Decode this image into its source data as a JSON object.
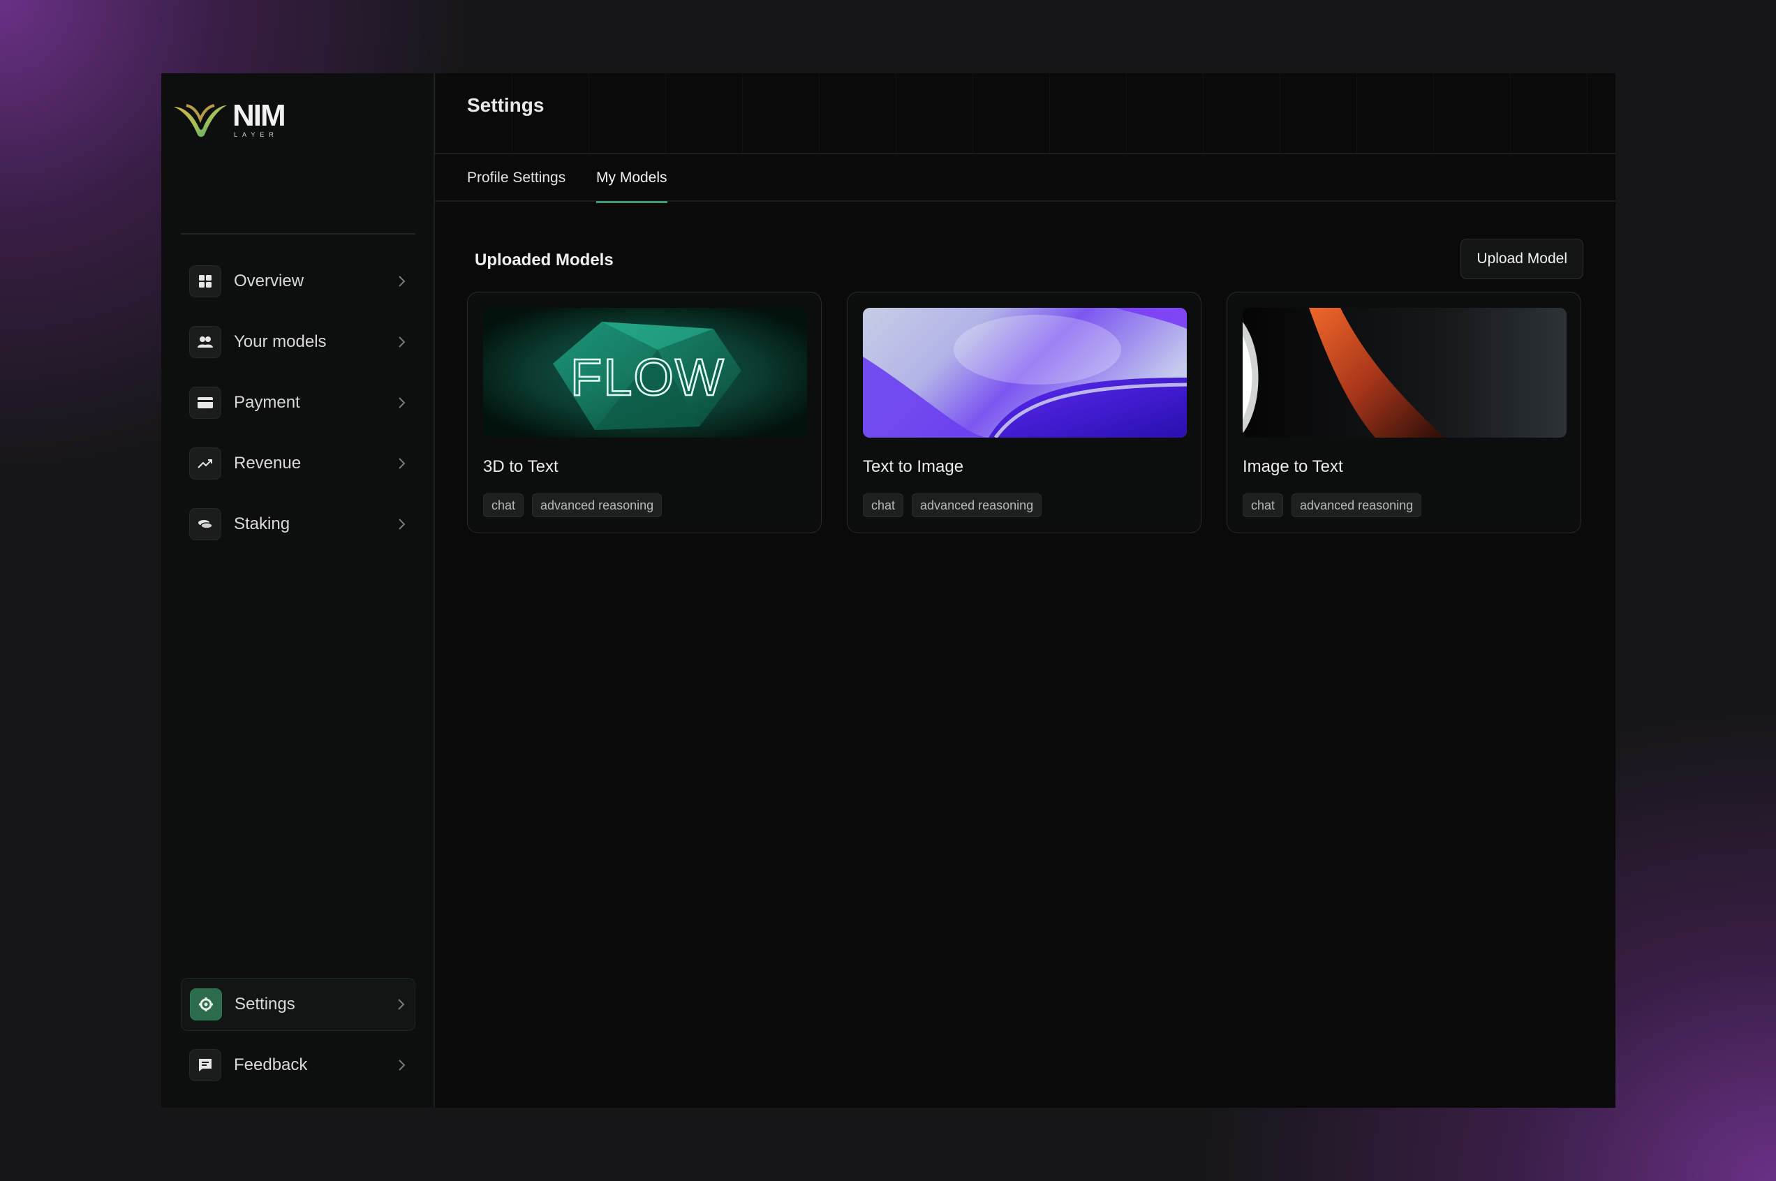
{
  "app": {
    "logo_text": "NIM",
    "logo_subtext": "LAYER"
  },
  "sidebar": {
    "items": [
      {
        "label": "Overview",
        "icon": "grid-icon"
      },
      {
        "label": "Your models",
        "icon": "users-icon"
      },
      {
        "label": "Payment",
        "icon": "card-icon"
      },
      {
        "label": "Revenue",
        "icon": "trend-up-icon"
      },
      {
        "label": "Staking",
        "icon": "coins-icon"
      }
    ],
    "bottom_items": [
      {
        "label": "Settings",
        "icon": "gear-icon",
        "active": true
      },
      {
        "label": "Feedback",
        "icon": "message-icon"
      }
    ]
  },
  "header": {
    "title": "Settings"
  },
  "tabs": [
    {
      "label": "Profile Settings",
      "active": false
    },
    {
      "label": "My Models",
      "active": true
    }
  ],
  "section": {
    "title": "Uploaded Models",
    "upload_label": "Upload Model"
  },
  "models": [
    {
      "title": "3D to Text",
      "tags": [
        "chat",
        "advanced reasoning"
      ],
      "thumb_text": "FLOW"
    },
    {
      "title": "Text to Image",
      "tags": [
        "chat",
        "advanced reasoning"
      ]
    },
    {
      "title": "Image to Text",
      "tags": [
        "chat",
        "advanced reasoning"
      ]
    }
  ],
  "colors": {
    "accent": "#3f9a74",
    "background": "#0a0a0b",
    "sidebar": "#0d0e0e"
  }
}
